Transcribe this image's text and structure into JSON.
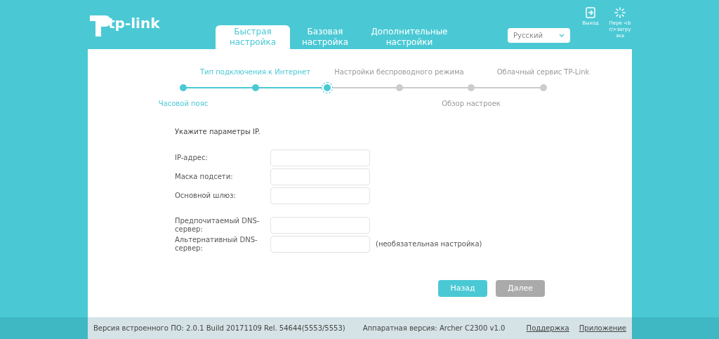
{
  "header": {
    "logo": "tp-link",
    "tabs": [
      {
        "label": "Быстрая настройка",
        "selected": true
      },
      {
        "label": "Базовая настройка",
        "selected": false
      },
      {
        "label": "Дополнительные настройки",
        "selected": false
      }
    ],
    "language": "Русский",
    "actions": [
      {
        "kind": "logout",
        "label": "Выход"
      },
      {
        "kind": "reboot",
        "label": "Пере <br/>загрузка"
      }
    ]
  },
  "steps": [
    {
      "label": "Часовой пояс",
      "completed": true,
      "current": false
    },
    {
      "label": "Тип подключения к Интернет",
      "completed": true,
      "current": false
    },
    {
      "completed": false,
      "current": true
    },
    {
      "label": "Настройки беспроводного режима",
      "completed": false,
      "current": false
    },
    {
      "label": "Обзор настроек",
      "completed": false,
      "current": false
    },
    {
      "label": "Облачный сервис TP-Link",
      "completed": false,
      "current": false
    }
  ],
  "form": {
    "intro": "Укажите параметры IP.",
    "fields": [
      {
        "label": "IP-адрес:"
      },
      {
        "label": "Маска подсети:"
      },
      {
        "label": "Основной шлюз:"
      },
      {
        "label": "Предпочитаемый DNS-сервер:"
      },
      {
        "label": "Альтернативный DNS-сервер:",
        "note": "(необязательная настройка)"
      }
    ]
  },
  "buttons": [
    {
      "label": "Назад",
      "kind": "primary"
    },
    {
      "label": "Далее",
      "kind": "secondary"
    }
  ],
  "footer": {
    "firmware": "Версия встроенного ПО: 2.0.1 Build 20171109 Rel. 54644(5553/5553)",
    "hardware": "Аппаратная версия: Archer C2300 v1.0",
    "links": [
      "Поддержка",
      "Приложение"
    ]
  }
}
